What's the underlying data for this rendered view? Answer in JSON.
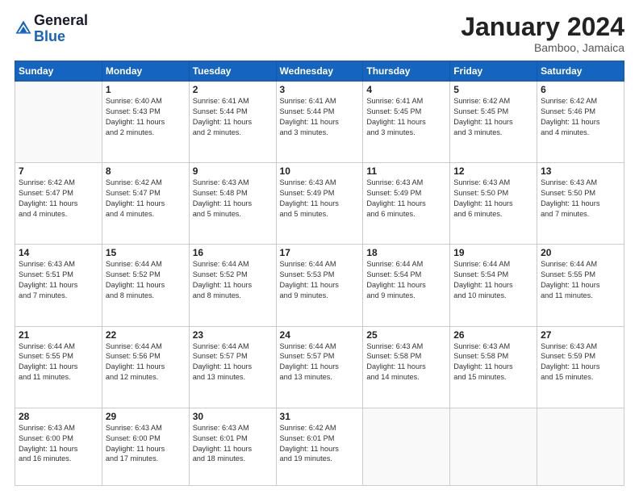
{
  "header": {
    "logo_general": "General",
    "logo_blue": "Blue",
    "month_title": "January 2024",
    "location": "Bamboo, Jamaica"
  },
  "days_of_week": [
    "Sunday",
    "Monday",
    "Tuesday",
    "Wednesday",
    "Thursday",
    "Friday",
    "Saturday"
  ],
  "weeks": [
    [
      {
        "day": "",
        "info": ""
      },
      {
        "day": "1",
        "info": "Sunrise: 6:40 AM\nSunset: 5:43 PM\nDaylight: 11 hours\nand 2 minutes."
      },
      {
        "day": "2",
        "info": "Sunrise: 6:41 AM\nSunset: 5:44 PM\nDaylight: 11 hours\nand 2 minutes."
      },
      {
        "day": "3",
        "info": "Sunrise: 6:41 AM\nSunset: 5:44 PM\nDaylight: 11 hours\nand 3 minutes."
      },
      {
        "day": "4",
        "info": "Sunrise: 6:41 AM\nSunset: 5:45 PM\nDaylight: 11 hours\nand 3 minutes."
      },
      {
        "day": "5",
        "info": "Sunrise: 6:42 AM\nSunset: 5:45 PM\nDaylight: 11 hours\nand 3 minutes."
      },
      {
        "day": "6",
        "info": "Sunrise: 6:42 AM\nSunset: 5:46 PM\nDaylight: 11 hours\nand 4 minutes."
      }
    ],
    [
      {
        "day": "7",
        "info": "Sunrise: 6:42 AM\nSunset: 5:47 PM\nDaylight: 11 hours\nand 4 minutes."
      },
      {
        "day": "8",
        "info": "Sunrise: 6:42 AM\nSunset: 5:47 PM\nDaylight: 11 hours\nand 4 minutes."
      },
      {
        "day": "9",
        "info": "Sunrise: 6:43 AM\nSunset: 5:48 PM\nDaylight: 11 hours\nand 5 minutes."
      },
      {
        "day": "10",
        "info": "Sunrise: 6:43 AM\nSunset: 5:49 PM\nDaylight: 11 hours\nand 5 minutes."
      },
      {
        "day": "11",
        "info": "Sunrise: 6:43 AM\nSunset: 5:49 PM\nDaylight: 11 hours\nand 6 minutes."
      },
      {
        "day": "12",
        "info": "Sunrise: 6:43 AM\nSunset: 5:50 PM\nDaylight: 11 hours\nand 6 minutes."
      },
      {
        "day": "13",
        "info": "Sunrise: 6:43 AM\nSunset: 5:50 PM\nDaylight: 11 hours\nand 7 minutes."
      }
    ],
    [
      {
        "day": "14",
        "info": "Sunrise: 6:43 AM\nSunset: 5:51 PM\nDaylight: 11 hours\nand 7 minutes."
      },
      {
        "day": "15",
        "info": "Sunrise: 6:44 AM\nSunset: 5:52 PM\nDaylight: 11 hours\nand 8 minutes."
      },
      {
        "day": "16",
        "info": "Sunrise: 6:44 AM\nSunset: 5:52 PM\nDaylight: 11 hours\nand 8 minutes."
      },
      {
        "day": "17",
        "info": "Sunrise: 6:44 AM\nSunset: 5:53 PM\nDaylight: 11 hours\nand 9 minutes."
      },
      {
        "day": "18",
        "info": "Sunrise: 6:44 AM\nSunset: 5:54 PM\nDaylight: 11 hours\nand 9 minutes."
      },
      {
        "day": "19",
        "info": "Sunrise: 6:44 AM\nSunset: 5:54 PM\nDaylight: 11 hours\nand 10 minutes."
      },
      {
        "day": "20",
        "info": "Sunrise: 6:44 AM\nSunset: 5:55 PM\nDaylight: 11 hours\nand 11 minutes."
      }
    ],
    [
      {
        "day": "21",
        "info": "Sunrise: 6:44 AM\nSunset: 5:55 PM\nDaylight: 11 hours\nand 11 minutes."
      },
      {
        "day": "22",
        "info": "Sunrise: 6:44 AM\nSunset: 5:56 PM\nDaylight: 11 hours\nand 12 minutes."
      },
      {
        "day": "23",
        "info": "Sunrise: 6:44 AM\nSunset: 5:57 PM\nDaylight: 11 hours\nand 13 minutes."
      },
      {
        "day": "24",
        "info": "Sunrise: 6:44 AM\nSunset: 5:57 PM\nDaylight: 11 hours\nand 13 minutes."
      },
      {
        "day": "25",
        "info": "Sunrise: 6:43 AM\nSunset: 5:58 PM\nDaylight: 11 hours\nand 14 minutes."
      },
      {
        "day": "26",
        "info": "Sunrise: 6:43 AM\nSunset: 5:58 PM\nDaylight: 11 hours\nand 15 minutes."
      },
      {
        "day": "27",
        "info": "Sunrise: 6:43 AM\nSunset: 5:59 PM\nDaylight: 11 hours\nand 15 minutes."
      }
    ],
    [
      {
        "day": "28",
        "info": "Sunrise: 6:43 AM\nSunset: 6:00 PM\nDaylight: 11 hours\nand 16 minutes."
      },
      {
        "day": "29",
        "info": "Sunrise: 6:43 AM\nSunset: 6:00 PM\nDaylight: 11 hours\nand 17 minutes."
      },
      {
        "day": "30",
        "info": "Sunrise: 6:43 AM\nSunset: 6:01 PM\nDaylight: 11 hours\nand 18 minutes."
      },
      {
        "day": "31",
        "info": "Sunrise: 6:42 AM\nSunset: 6:01 PM\nDaylight: 11 hours\nand 19 minutes."
      },
      {
        "day": "",
        "info": ""
      },
      {
        "day": "",
        "info": ""
      },
      {
        "day": "",
        "info": ""
      }
    ]
  ]
}
